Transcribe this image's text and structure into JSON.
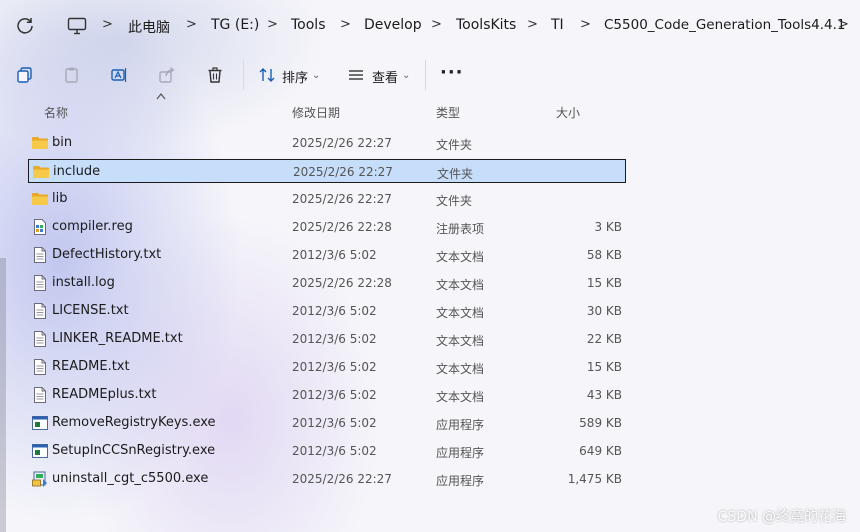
{
  "breadcrumb": [
    "此电脑",
    "TG (E:)",
    "Tools",
    "Develop",
    "ToolsKits",
    "TI",
    "C5500_Code_Generation_Tools4.4.1"
  ],
  "toolbar": {
    "sort_label": "排序",
    "view_label": "查看",
    "more_label": "···"
  },
  "columns": {
    "name": "名称",
    "modified": "修改日期",
    "type": "类型",
    "size": "大小"
  },
  "files": [
    {
      "name": "bin",
      "modified": "2025/2/26 22:27",
      "type": "文件夹",
      "size": "",
      "icon": "folder-icon"
    },
    {
      "name": "include",
      "modified": "2025/2/26 22:27",
      "type": "文件夹",
      "size": "",
      "icon": "folder-icon"
    },
    {
      "name": "lib",
      "modified": "2025/2/26 22:27",
      "type": "文件夹",
      "size": "",
      "icon": "folder-icon"
    },
    {
      "name": "compiler.reg",
      "modified": "2025/2/26 22:28",
      "type": "注册表项",
      "size": "3 KB",
      "icon": "registry-file-icon"
    },
    {
      "name": "DefectHistory.txt",
      "modified": "2012/3/6 5:02",
      "type": "文本文档",
      "size": "58 KB",
      "icon": "text-file-icon"
    },
    {
      "name": "install.log",
      "modified": "2025/2/26 22:28",
      "type": "文本文档",
      "size": "15 KB",
      "icon": "text-file-icon"
    },
    {
      "name": "LICENSE.txt",
      "modified": "2012/3/6 5:02",
      "type": "文本文档",
      "size": "30 KB",
      "icon": "text-file-icon"
    },
    {
      "name": "LINKER_README.txt",
      "modified": "2012/3/6 5:02",
      "type": "文本文档",
      "size": "22 KB",
      "icon": "text-file-icon"
    },
    {
      "name": "README.txt",
      "modified": "2012/3/6 5:02",
      "type": "文本文档",
      "size": "15 KB",
      "icon": "text-file-icon"
    },
    {
      "name": "READMEplus.txt",
      "modified": "2012/3/6 5:02",
      "type": "文本文档",
      "size": "43 KB",
      "icon": "text-file-icon"
    },
    {
      "name": "RemoveRegistryKeys.exe",
      "modified": "2012/3/6 5:02",
      "type": "应用程序",
      "size": "589 KB",
      "icon": "application-icon"
    },
    {
      "name": "SetupInCCSnRegistry.exe",
      "modified": "2012/3/6 5:02",
      "type": "应用程序",
      "size": "649 KB",
      "icon": "application-icon"
    },
    {
      "name": "uninstall_cgt_c5500.exe",
      "modified": "2025/2/26 22:27",
      "type": "应用程序",
      "size": "1,475 KB",
      "icon": "installer-icon"
    }
  ],
  "selected_file": "include",
  "watermark": "CSDN @终竟的花海",
  "colors": {
    "selection": "#c7defa",
    "folder": "#f5c242",
    "text": "#1b1b1b",
    "muted": "#555555"
  }
}
